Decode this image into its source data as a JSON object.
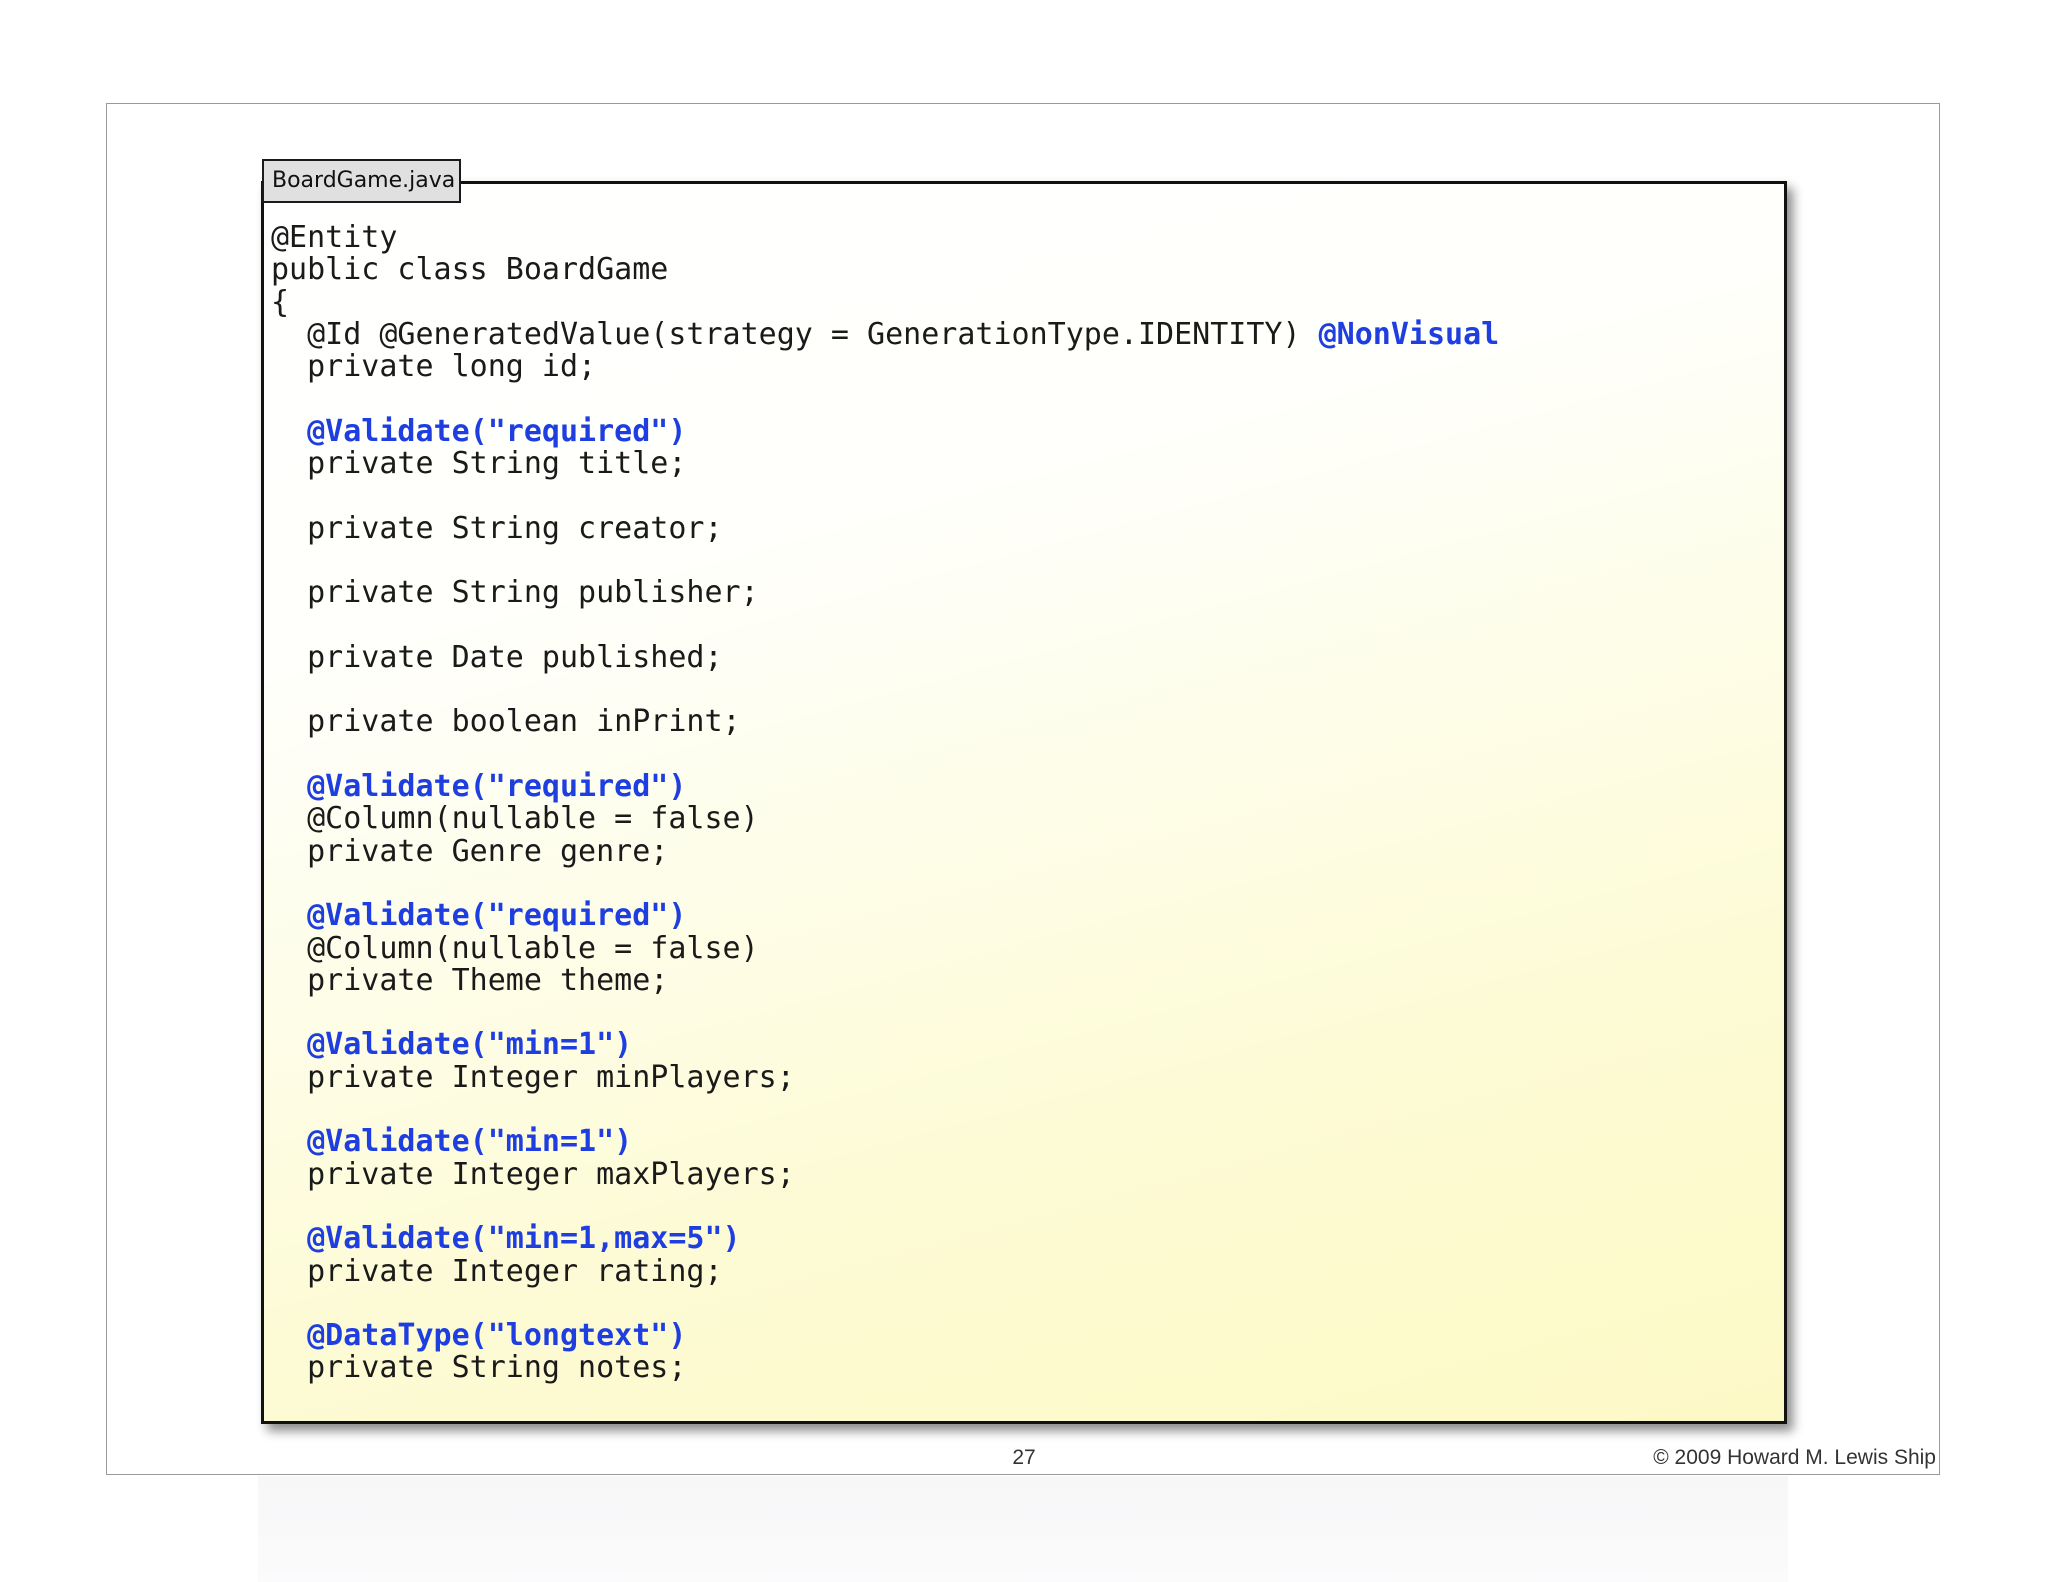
{
  "file_tab": "BoardGame.java",
  "code_lines": [
    [
      {
        "t": "@Entity"
      }
    ],
    [
      {
        "t": "public class BoardGame"
      }
    ],
    [
      {
        "t": "{"
      }
    ],
    [
      {
        "t": "  @Id @GeneratedValue(strategy = GenerationType.IDENTITY) "
      },
      {
        "t": "@NonVisual",
        "hl": true
      }
    ],
    [
      {
        "t": "  private long id;"
      }
    ],
    [
      {
        "t": ""
      }
    ],
    [
      {
        "t": "  "
      },
      {
        "t": "@Validate(\"required\")",
        "hl": true
      }
    ],
    [
      {
        "t": "  private String title;"
      }
    ],
    [
      {
        "t": ""
      }
    ],
    [
      {
        "t": "  private String creator;"
      }
    ],
    [
      {
        "t": ""
      }
    ],
    [
      {
        "t": "  private String publisher;"
      }
    ],
    [
      {
        "t": ""
      }
    ],
    [
      {
        "t": "  private Date published;"
      }
    ],
    [
      {
        "t": ""
      }
    ],
    [
      {
        "t": "  private boolean inPrint;"
      }
    ],
    [
      {
        "t": ""
      }
    ],
    [
      {
        "t": "  "
      },
      {
        "t": "@Validate(\"required\")",
        "hl": true
      }
    ],
    [
      {
        "t": "  @Column(nullable = false)"
      }
    ],
    [
      {
        "t": "  private Genre genre;"
      }
    ],
    [
      {
        "t": ""
      }
    ],
    [
      {
        "t": "  "
      },
      {
        "t": "@Validate(\"required\")",
        "hl": true
      }
    ],
    [
      {
        "t": "  @Column(nullable = false)"
      }
    ],
    [
      {
        "t": "  private Theme theme;"
      }
    ],
    [
      {
        "t": ""
      }
    ],
    [
      {
        "t": "  "
      },
      {
        "t": "@Validate(\"min=1\")",
        "hl": true
      }
    ],
    [
      {
        "t": "  private Integer minPlayers;"
      }
    ],
    [
      {
        "t": ""
      }
    ],
    [
      {
        "t": "  "
      },
      {
        "t": "@Validate(\"min=1\")",
        "hl": true
      }
    ],
    [
      {
        "t": "  private Integer maxPlayers;"
      }
    ],
    [
      {
        "t": ""
      }
    ],
    [
      {
        "t": "  "
      },
      {
        "t": "@Validate(\"min=1,max=5\")",
        "hl": true
      }
    ],
    [
      {
        "t": "  private Integer rating;"
      }
    ],
    [
      {
        "t": ""
      }
    ],
    [
      {
        "t": "  "
      },
      {
        "t": "@DataType(\"longtext\")",
        "hl": true
      }
    ],
    [
      {
        "t": "  private String notes;"
      }
    ]
  ],
  "footer": {
    "page_number": "27",
    "copyright": "© 2009 Howard M. Lewis Ship"
  },
  "colors": {
    "annotation_highlight": "#1e3ee0",
    "code_text": "#1a1a1a",
    "box_gradient_end": "#fdf9c6"
  }
}
